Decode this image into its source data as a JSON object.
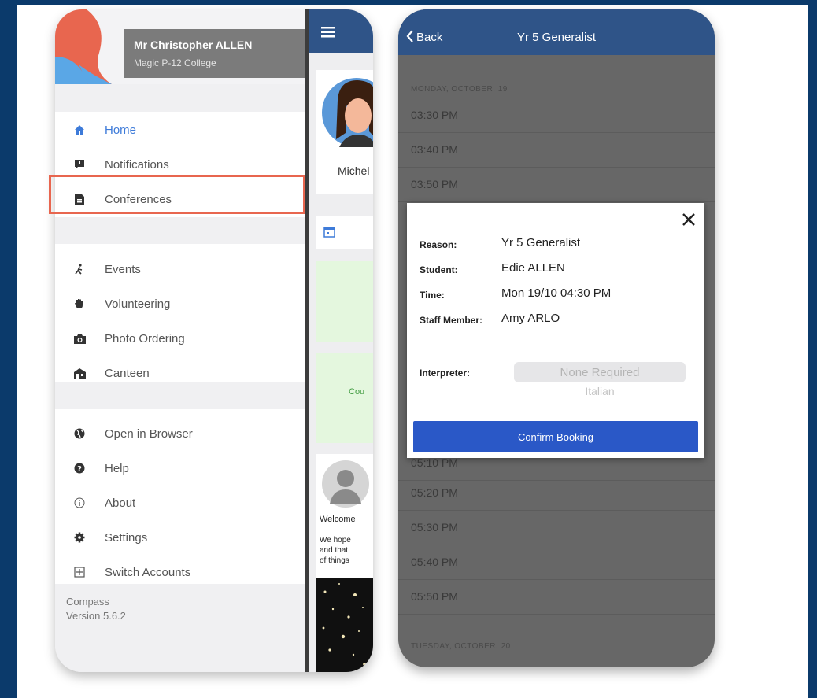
{
  "drawer": {
    "user_name": "Mr Christopher ALLEN",
    "school": "Magic P-12 College",
    "menu_primary": [
      {
        "label": "Home",
        "icon": "home-icon",
        "active": true
      },
      {
        "label": "Notifications",
        "icon": "notification-icon"
      },
      {
        "label": "Conferences",
        "icon": "document-icon"
      }
    ],
    "menu_secondary": [
      {
        "label": "Events",
        "icon": "running-person-icon"
      },
      {
        "label": "Volunteering",
        "icon": "hand-icon"
      },
      {
        "label": "Photo Ordering",
        "icon": "camera-icon"
      },
      {
        "label": "Canteen",
        "icon": "canteen-icon"
      }
    ],
    "menu_tertiary": [
      {
        "label": "Open in Browser",
        "icon": "globe-icon"
      },
      {
        "label": "Help",
        "icon": "help-icon"
      },
      {
        "label": "About",
        "icon": "info-icon"
      },
      {
        "label": "Settings",
        "icon": "gear-icon"
      },
      {
        "label": "Switch Accounts",
        "icon": "switch-accounts-icon"
      }
    ],
    "app_name": "Compass",
    "version": "Version 5.6.2"
  },
  "main_pane": {
    "profile_name": "Michel",
    "green_card_text": "Cou",
    "welcome_title": "Welcome",
    "welcome_lines": [
      "We hope",
      "and that",
      "of things"
    ]
  },
  "booking": {
    "back_label": "Back",
    "title": "Yr 5 Generalist",
    "day1_header": "MONDAY, OCTOBER, 19",
    "slots_before": [
      "03:30 PM",
      "03:40 PM",
      "03:50 PM"
    ],
    "slot_partial": "05:10 PM",
    "slots_after": [
      "05:20 PM",
      "05:30 PM",
      "05:40 PM",
      "05:50 PM"
    ],
    "day2_header": "TUESDAY, OCTOBER, 20"
  },
  "modal": {
    "reason_label": "Reason:",
    "reason_value": "Yr 5 Generalist",
    "student_label": "Student:",
    "student_value": "Edie ALLEN",
    "time_label": "Time:",
    "time_value": "Mon 19/10 04:30 PM",
    "staff_label": "Staff Member:",
    "staff_value": "Amy ARLO",
    "interpreter_label": "Interpreter:",
    "interpreter_selected": "None Required",
    "interpreter_next_option": "Italian",
    "confirm_label": "Confirm Booking"
  },
  "colors": {
    "background": "#0b3a6b",
    "topbar": "#2f5488",
    "active": "#3e7bd9",
    "highlight": "#e8664f",
    "confirm": "#2a58c7"
  }
}
